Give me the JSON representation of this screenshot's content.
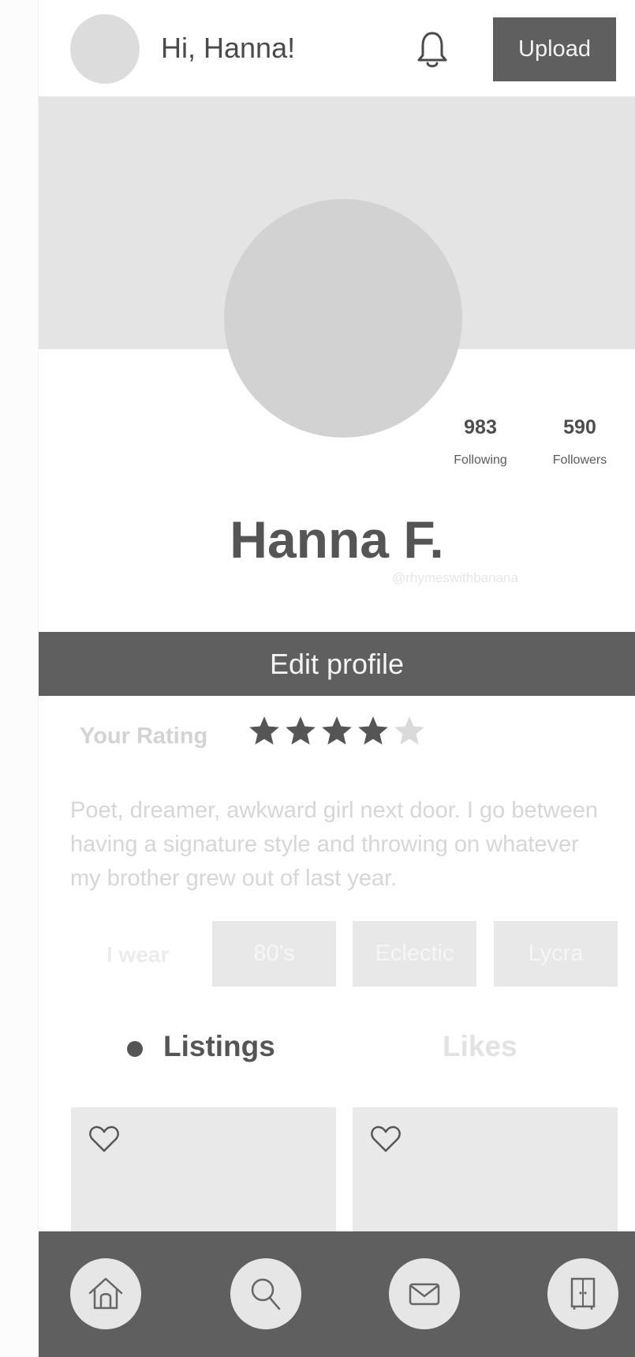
{
  "header": {
    "greeting": "Hi, Hanna!",
    "upload_label": "Upload"
  },
  "profile": {
    "name": "Hanna F.",
    "handle": "@rhymeswithbanana",
    "following_count": "983",
    "following_label": "Following",
    "followers_count": "590",
    "followers_label": "Followers",
    "edit_label": "Edit profile"
  },
  "rating": {
    "label": "Your Rating",
    "value": 4,
    "max": 5
  },
  "bio": "Poet, dreamer, awkward girl next door. I go between having a signature style and throwing on whatever my brother grew out of last year.",
  "style": {
    "label": "I wear",
    "tags": [
      "80's",
      "Eclectic",
      "Lycra"
    ]
  },
  "tabs": {
    "listings": "Listings",
    "likes": "Likes",
    "active": "Listings"
  },
  "listings": [
    {
      "liked": false
    },
    {
      "liked": false
    }
  ],
  "bottom_nav": [
    {
      "icon": "home-icon"
    },
    {
      "icon": "search-icon"
    },
    {
      "icon": "mail-icon"
    },
    {
      "icon": "closet-icon"
    }
  ],
  "colors": {
    "dark": "#5f5f5f",
    "star_on": "#555555",
    "star_off": "#dadada"
  }
}
